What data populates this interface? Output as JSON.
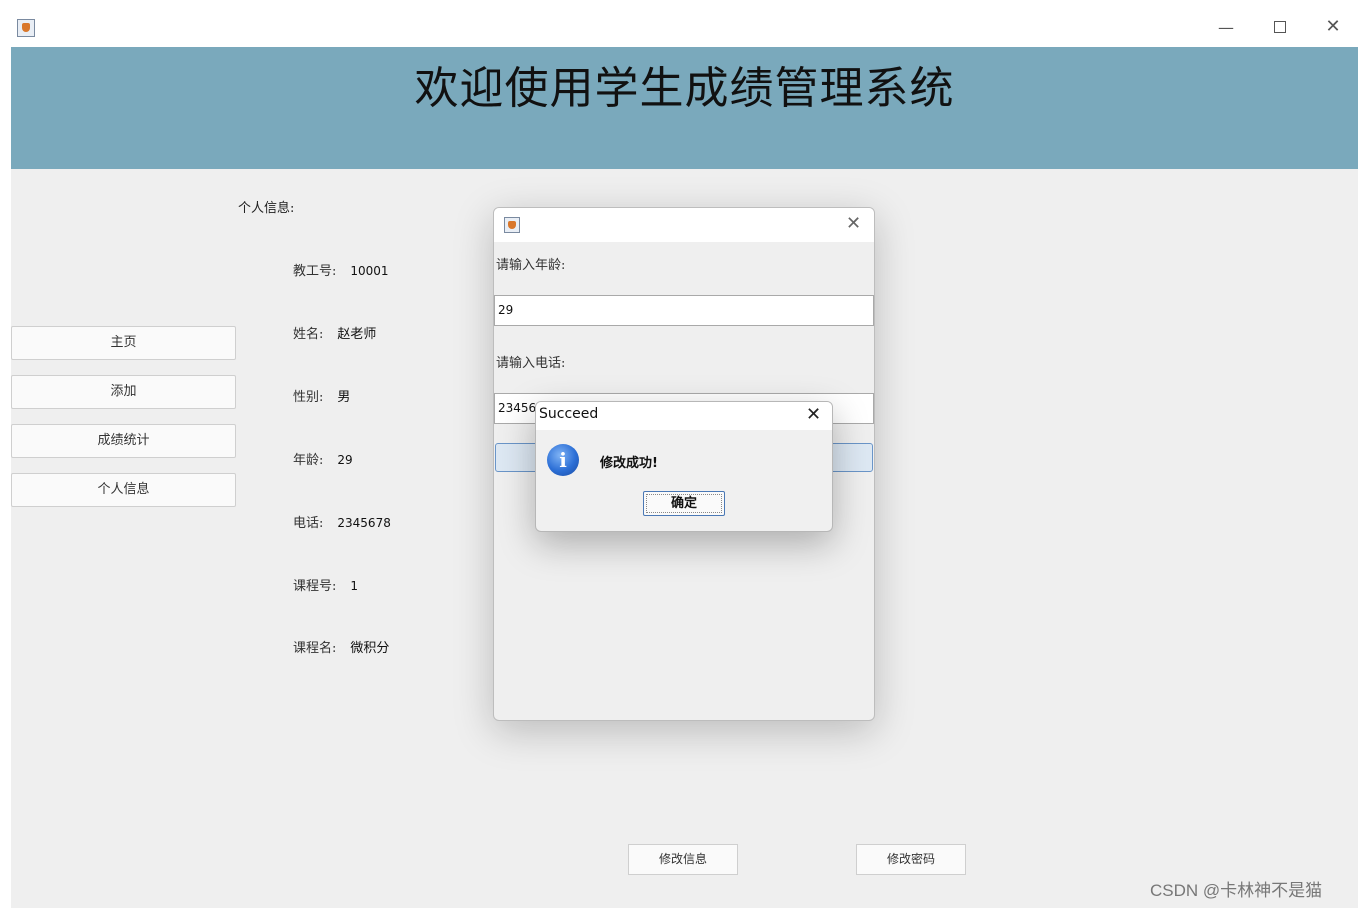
{
  "window": {
    "icon": "java-app-icon",
    "controls": {
      "minimize": "—",
      "maximize": "",
      "close": "✕"
    }
  },
  "header": {
    "title": "欢迎使用学生成绩管理系统"
  },
  "sidebar": {
    "items": [
      {
        "label": "主页"
      },
      {
        "label": "添加"
      },
      {
        "label": "成绩统计"
      },
      {
        "label": "个人信息"
      }
    ]
  },
  "personal_info": {
    "section_label": "个人信息:",
    "fields": [
      {
        "label": "教工号:",
        "value": "10001"
      },
      {
        "label": "姓名:",
        "value": "赵老师"
      },
      {
        "label": "性别:",
        "value": "男"
      },
      {
        "label": "年龄:",
        "value": "29"
      },
      {
        "label": "电话:",
        "value": "2345678"
      },
      {
        "label": "课程号:",
        "value": "1"
      },
      {
        "label": "课程名:",
        "value": "微积分"
      }
    ]
  },
  "bottom_buttons": {
    "modify_info": "修改信息",
    "modify_password": "修改密码"
  },
  "edit_dialog": {
    "close": "✕",
    "age_prompt": "请输入年龄:",
    "age_value": "29",
    "phone_prompt": "请输入电话:",
    "phone_value": "23456"
  },
  "success_dialog": {
    "title": "Succeed",
    "close": "✕",
    "icon": "info-icon",
    "message": "修改成功!",
    "ok": "确定"
  },
  "watermark": "CSDN @卡林神不是猫"
}
